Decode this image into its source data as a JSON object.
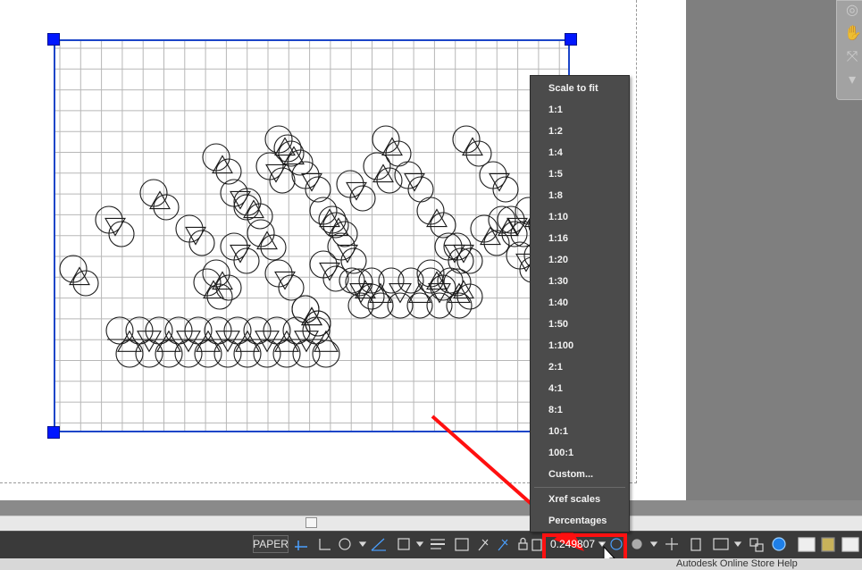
{
  "status_bar": {
    "paper_label": "PAPER",
    "scale_value": "0.249807"
  },
  "scale_menu": {
    "items": [
      "Scale to fit",
      "1:1",
      "1:2",
      "1:4",
      "1:5",
      "1:8",
      "1:10",
      "1:16",
      "1:20",
      "1:30",
      "1:40",
      "1:50",
      "1:100",
      "2:1",
      "4:1",
      "8:1",
      "10:1",
      "100:1",
      "Custom..."
    ],
    "extra_items": [
      "Xref scales",
      "Percentages"
    ]
  },
  "footer": {
    "text": "Autodesk Online Store Help"
  },
  "colors": {
    "viewport_border": "#1b45c8",
    "grip": "#0017ff",
    "highlight": "#ff1010",
    "menu_bg": "#4b4b4b",
    "status_bar_bg": "#3a3a3a"
  }
}
